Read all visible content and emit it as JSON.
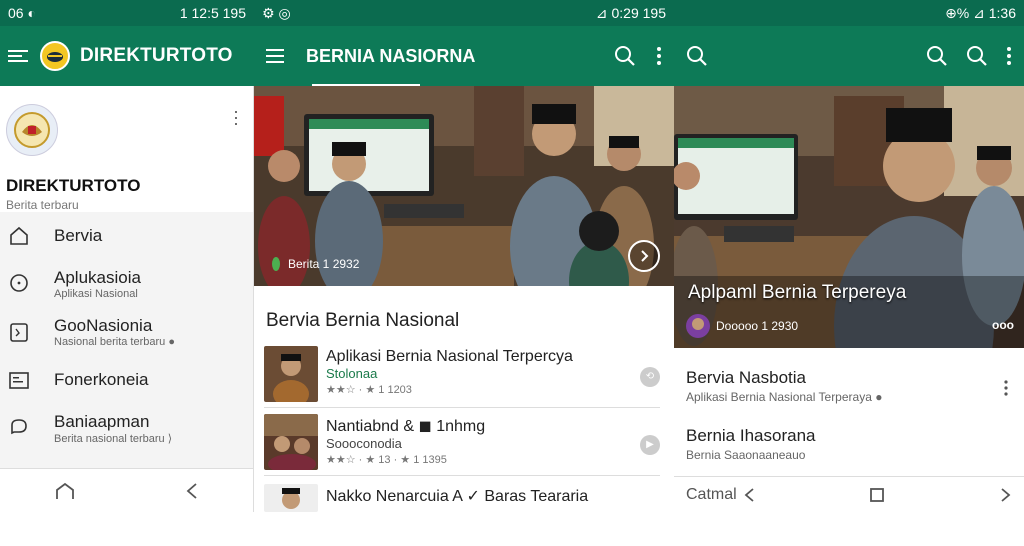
{
  "panel1": {
    "status": {
      "left": "06 ◐",
      "right": "1 12:5  195"
    },
    "app_title": "DIREKTURTOTO",
    "drawer": {
      "title": "DIREKTURTOTO",
      "subtitle": "Berita terbaru",
      "items": [
        {
          "label": "Bervia",
          "sub": ""
        },
        {
          "label": "Aplukasioia",
          "sub": "Aplikasi Nasional"
        },
        {
          "label": "GooNasionia",
          "sub": "Nasional berita terbaru ●"
        },
        {
          "label": "Fonerkoneia",
          "sub": ""
        },
        {
          "label": "Baniaapman",
          "sub": "Berita nasional terbaru ⟩"
        }
      ]
    }
  },
  "panel2": {
    "status": {
      "left": "⚙ ◎",
      "right": "⊿ 0:29  195"
    },
    "title": "BERNIA NASIORNA",
    "hero_caption": "Berita 1 2932",
    "section_title": "Bervia Bernia Nasional",
    "articles": [
      {
        "title": "Aplikasi Bernia Nasional Terpercya",
        "tag": "Stolonaa",
        "meta": "★★☆ · ★ 1 1203"
      },
      {
        "title": "Nantiabnd & ◼ 1nhmg",
        "tag": "Soooconodia",
        "meta": "★★☆ · ★ 13 · ★ 1 1395"
      },
      {
        "title": "Nakko Nenarcuia A ✓ Baras Teararia",
        "tag": "",
        "meta": ""
      }
    ]
  },
  "panel3": {
    "status": {
      "left": "",
      "right": "⊕% ⊿  1:36"
    },
    "hero_title": "Aplpaml Bernia Terpereya",
    "hero_caption": "Dooooo 1 2930",
    "hero_badge": "ooo",
    "items": [
      {
        "title": "Bervia Nasbotia",
        "sub": "Aplikasi Bernia Nasional Terperaya ●"
      },
      {
        "title": "Bernia Ihasorana",
        "sub": "Bernia Saaonaaneauo"
      }
    ],
    "bottom_label": "Catmal"
  }
}
